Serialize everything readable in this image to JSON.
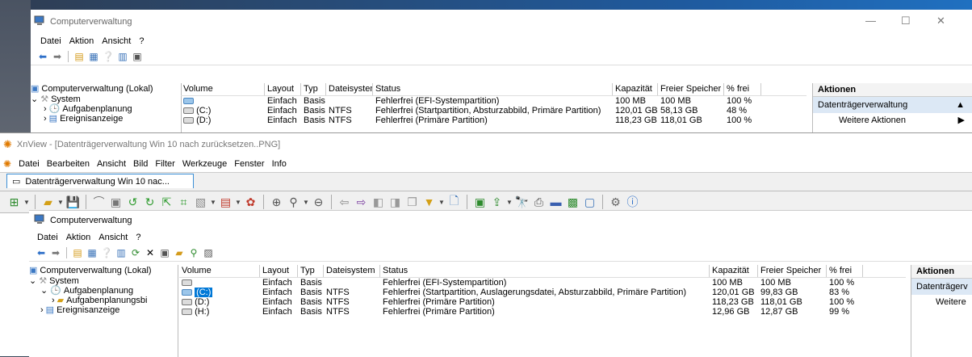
{
  "back": {
    "title": "Computerverwaltung",
    "menu": [
      "Datei",
      "Aktion",
      "Ansicht",
      "?"
    ],
    "tree": [
      "Computerverwaltung (Lokal)",
      "System",
      "Aufgabenplanung",
      "Ereignisanzeige"
    ],
    "columns": [
      "Volume",
      "Layout",
      "Typ",
      "Dateisystem",
      "Status",
      "Kapazität",
      "Freier Speicher",
      "% frei"
    ],
    "rows": [
      [
        "",
        "Einfach",
        "Basis",
        "",
        "Fehlerfrei (EFI-Systempartition)",
        "100 MB",
        "100 MB",
        "100 %"
      ],
      [
        "(C:)",
        "Einfach",
        "Basis",
        "NTFS",
        "Fehlerfrei (Startpartition, Absturzabbild, Primäre Partition)",
        "120,01 GB",
        "58,13 GB",
        "48 %"
      ],
      [
        "(D:)",
        "Einfach",
        "Basis",
        "NTFS",
        "Fehlerfrei (Primäre Partition)",
        "118,23 GB",
        "118,01 GB",
        "100 %"
      ]
    ],
    "actions": {
      "header": "Aktionen",
      "selected": "Datenträgerverwaltung",
      "more": "Weitere Aktionen"
    }
  },
  "xnview": {
    "title": "XnView - [Datenträgerverwaltung Win 10 nach zurücksetzen..PNG]",
    "menu": [
      "Datei",
      "Bearbeiten",
      "Ansicht",
      "Bild",
      "Filter",
      "Werkzeuge",
      "Fenster",
      "Info"
    ],
    "tab": "Datenträgerverwaltung Win 10 nac..."
  },
  "inner": {
    "title": "Computerverwaltung",
    "menu": [
      "Datei",
      "Aktion",
      "Ansicht",
      "?"
    ],
    "tree": [
      "Computerverwaltung (Lokal)",
      "System",
      "Aufgabenplanung",
      "Aufgabenplanungsbi",
      "Ereignisanzeige"
    ],
    "columns": [
      "Volume",
      "Layout",
      "Typ",
      "Dateisystem",
      "Status",
      "Kapazität",
      "Freier Speicher",
      "% frei"
    ],
    "rows": [
      [
        "",
        "Einfach",
        "Basis",
        "",
        "Fehlerfrei (EFI-Systempartition)",
        "100 MB",
        "100 MB",
        "100 %"
      ],
      [
        "(C:)",
        "Einfach",
        "Basis",
        "NTFS",
        "Fehlerfrei (Startpartition, Auslagerungsdatei, Absturzabbild, Primäre Partition)",
        "120,01 GB",
        "99,83 GB",
        "83 %"
      ],
      [
        "(D:)",
        "Einfach",
        "Basis",
        "NTFS",
        "Fehlerfrei (Primäre Partition)",
        "118,23 GB",
        "118,01 GB",
        "100 %"
      ],
      [
        "(H:)",
        "Einfach",
        "Basis",
        "NTFS",
        "Fehlerfrei (Primäre Partition)",
        "12,96 GB",
        "12,87 GB",
        "99 %"
      ]
    ],
    "actions": {
      "header": "Aktionen",
      "selected": "Datenträgerv",
      "more": "Weitere"
    }
  }
}
